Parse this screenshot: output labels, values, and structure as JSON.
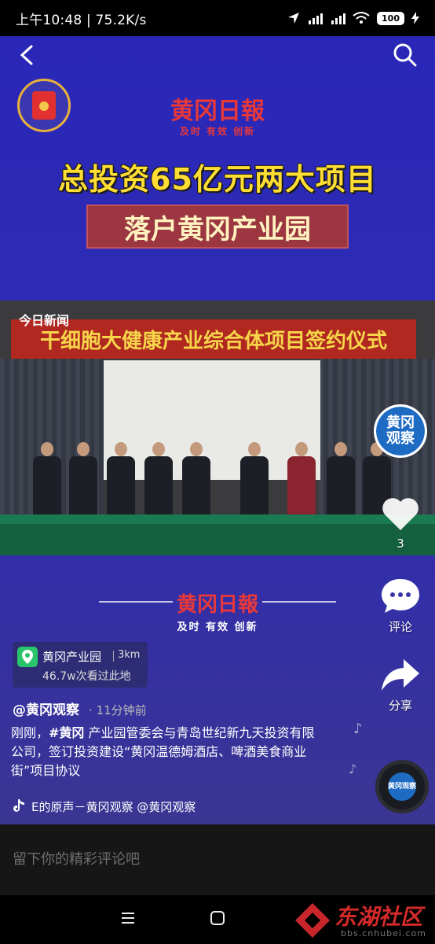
{
  "status_bar": {
    "time_speed": "上午10:48 | 75.2K/s",
    "battery": "100"
  },
  "video": {
    "brand": "黄冈日報",
    "brand_slogan": "及时 有效 创新",
    "headline1": "总投资65亿元两大项目",
    "headline2": "落户黄冈产业园",
    "news_tag": "今日新闻",
    "banner": "干细胞大健康产业综合体项目签约仪式",
    "brand_bottom": "黄冈日報",
    "brand_bottom_slogan": "及时 有效 创新"
  },
  "rail": {
    "avatar_text1": "黄冈",
    "avatar_text2": "观察",
    "like_count": "3",
    "comment_label": "评论",
    "share_label": "分享",
    "disc_text": "黄冈观察"
  },
  "location": {
    "name": "黄冈产业园",
    "distance": "3km",
    "views": "46.7w次看过此地"
  },
  "post": {
    "author": "@黄冈观察",
    "time": "· 11分钟前",
    "desc_prefix": "刚刚，",
    "desc_tag": "#黄冈",
    "desc_rest": " 产业园管委会与青岛世纪新九天投资有限公司，签订投资建设“黄冈温德姆酒店、啤酒美食商业街”项目协议",
    "music": "E的原声－黄冈观察   @黄冈观察"
  },
  "comment_bar": {
    "placeholder": "留下你的精彩评论吧"
  },
  "watermark": {
    "title": "东湖社区",
    "url": "bbs.cnhubei.com"
  },
  "colors": {
    "background_top": "#2a27b8",
    "headline_yellow": "#ffdd33",
    "brand_red": "#e8383a",
    "location_green": "#29c46b"
  }
}
